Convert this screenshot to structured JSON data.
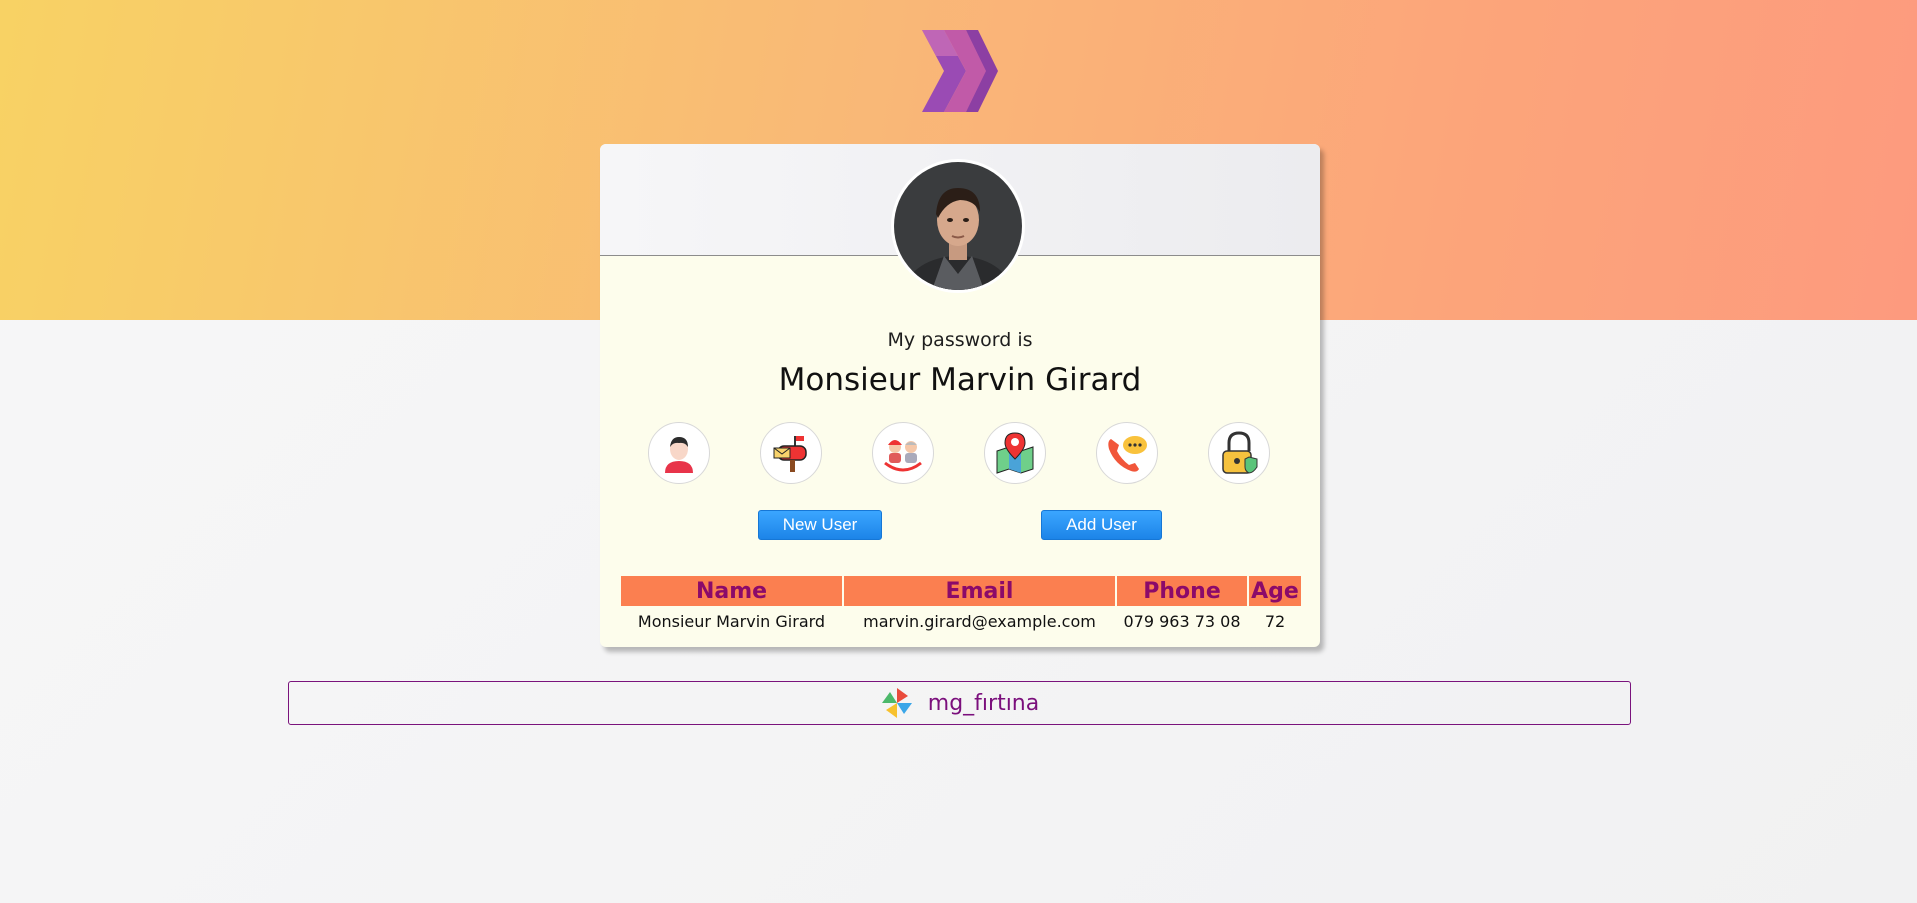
{
  "card": {
    "caption": "My password is",
    "value": "Monsieur Marvin Girard",
    "icons": [
      "user-icon",
      "mailbox-icon",
      "family-icon",
      "map-location-icon",
      "phone-chat-icon",
      "padlock-icon"
    ]
  },
  "buttons": {
    "new_user": "New User",
    "add_user": "Add User"
  },
  "table": {
    "headers": [
      "Name",
      "Email",
      "Phone",
      "Age"
    ],
    "rows": [
      [
        "Monsieur Marvin Girard",
        "marvin.girard@example.com",
        "079 963 73 08",
        "72"
      ]
    ]
  },
  "footer": {
    "label": "mg_fırtına"
  },
  "colors": {
    "accent": "#8b0a6a",
    "table_header": "#fb7f50",
    "button": "#1c84e8"
  }
}
